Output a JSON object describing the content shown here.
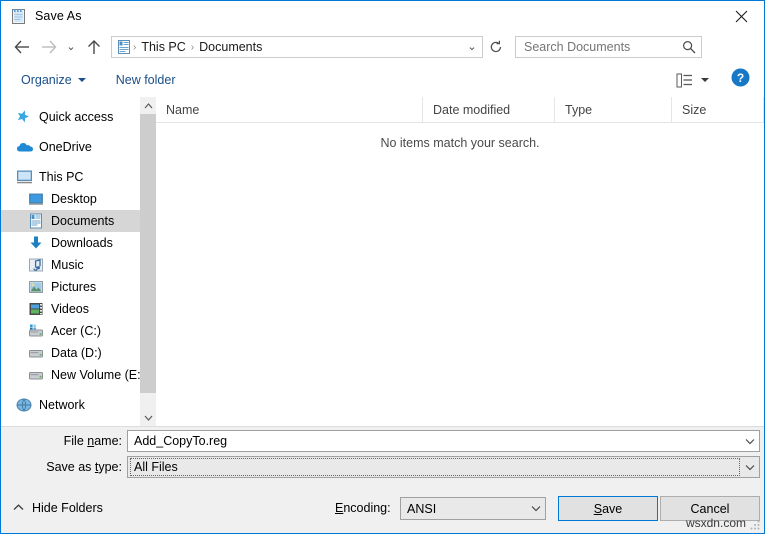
{
  "window": {
    "title": "Save As",
    "title_icon": "notepad-icon",
    "close_label": "✕",
    "accent_color": "#0078d7",
    "chrome_background": "#f0f0f0"
  },
  "nav": {
    "back_label": "←",
    "forward_label": "→",
    "recent_label": "⌄",
    "up_label": "↑",
    "address_icon": "documents-folder-icon",
    "breadcrumbs": [
      "This PC",
      "Documents"
    ],
    "breadcrumb_separator": "›",
    "address_dropdown_label": "⌄",
    "refresh_label": "↻"
  },
  "search": {
    "placeholder": "Search Documents",
    "value": "",
    "icon": "search-icon"
  },
  "toolbar": {
    "organize_label": "Organize",
    "new_folder_label": "New folder",
    "view_options_icon": "view-options-icon",
    "help_icon": "help-icon",
    "help_label": "?"
  },
  "sidebar": {
    "items": [
      {
        "label": "Quick access",
        "icon": "star-pin-icon",
        "level": 0,
        "selected": false
      },
      {
        "label": "OneDrive",
        "icon": "onedrive-cloud-icon",
        "level": 0,
        "selected": false
      },
      {
        "label": "This PC",
        "icon": "this-pc-monitor-icon",
        "level": 0,
        "selected": false
      },
      {
        "label": "Desktop",
        "icon": "desktop-icon",
        "level": 1,
        "selected": false
      },
      {
        "label": "Documents",
        "icon": "documents-icon",
        "level": 1,
        "selected": true
      },
      {
        "label": "Downloads",
        "icon": "downloads-arrow-icon",
        "level": 1,
        "selected": false
      },
      {
        "label": "Music",
        "icon": "music-icon",
        "level": 1,
        "selected": false
      },
      {
        "label": "Pictures",
        "icon": "pictures-icon",
        "level": 1,
        "selected": false
      },
      {
        "label": "Videos",
        "icon": "videos-icon",
        "level": 1,
        "selected": false
      },
      {
        "label": "Acer (C:)",
        "icon": "system-drive-icon",
        "level": 1,
        "selected": false
      },
      {
        "label": "Data (D:)",
        "icon": "drive-icon",
        "level": 1,
        "selected": false
      },
      {
        "label": "New Volume (E:)",
        "icon": "drive-icon",
        "level": 1,
        "selected": false
      },
      {
        "label": "Network",
        "icon": "network-icon",
        "level": 0,
        "selected": false
      }
    ],
    "scroll_up_label": "⌃",
    "scroll_down_label": "⌄"
  },
  "file_list": {
    "columns": [
      "Name",
      "Date modified",
      "Type",
      "Size"
    ],
    "sort_column": "Name",
    "sort_indicator": "⌃",
    "rows": [],
    "empty_message": "No items match your search."
  },
  "form": {
    "file_name": {
      "label_pre": "File ",
      "label_key": "n",
      "label_post": "ame:",
      "value": "Add_CopyTo.reg",
      "dropdown_label": "⌄"
    },
    "save_as_type": {
      "label_pre": "Save as ",
      "label_key": "t",
      "label_post": "ype:",
      "value": "All Files",
      "dropdown_label": "⌄"
    },
    "encoding": {
      "label_pre": "",
      "label_key": "E",
      "label_post": "ncoding:",
      "value": "ANSI",
      "dropdown_label": "⌄"
    },
    "hide_folders": {
      "label": "Hide Folders",
      "caret": "⌃"
    },
    "save_button": {
      "pre": "",
      "key": "S",
      "post": "ave"
    },
    "cancel_button": {
      "label": "Cancel"
    }
  },
  "watermark": {
    "text": "wsxdn.com"
  }
}
